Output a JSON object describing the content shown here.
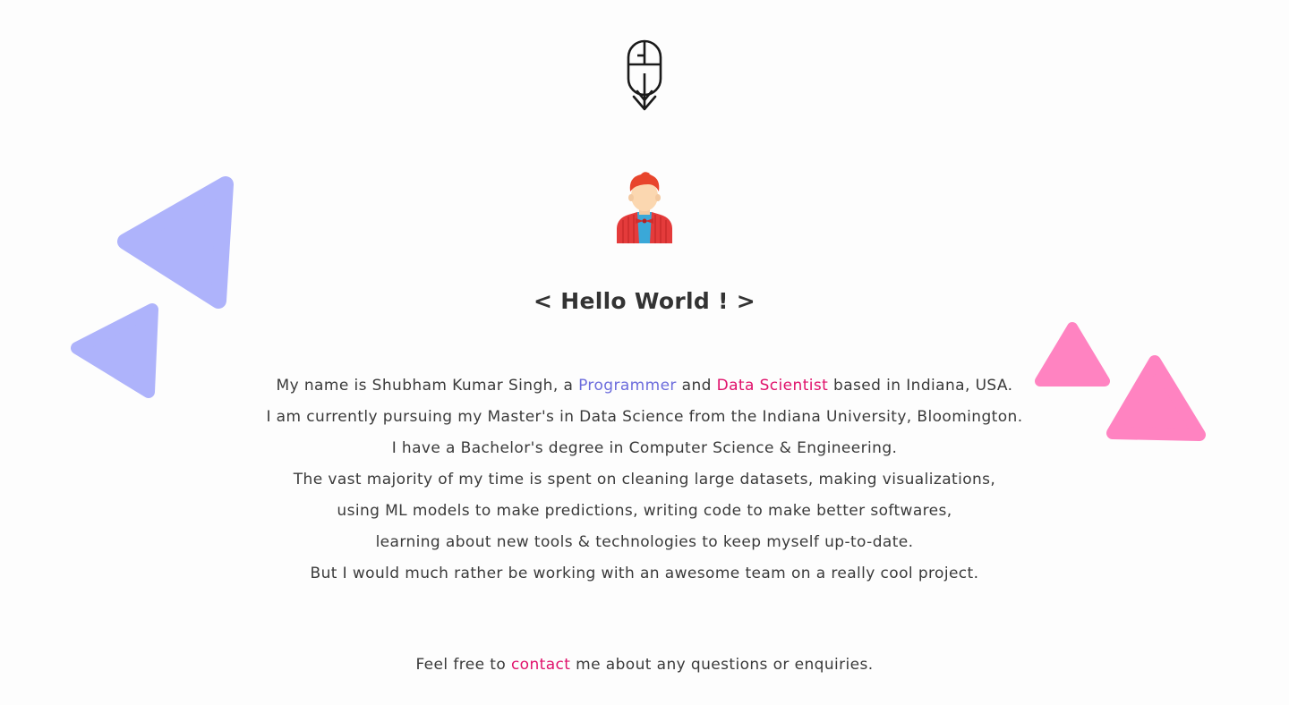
{
  "greeting": "< Hello World ! >",
  "bio": {
    "line1_prefix": "My name is Shubham Kumar Singh, a ",
    "line1_role1": "Programmer",
    "line1_mid": " and ",
    "line1_role2": "Data Scientist",
    "line1_suffix": " based in Indiana, USA.",
    "line2": "I am currently pursuing my Master's in Data Science from the Indiana University, Bloomington.",
    "line3": "I have a Bachelor's degree in Computer Science & Engineering.",
    "line4": "The vast majority of my time is spent on cleaning large datasets, making visualizations,",
    "line5": "using ML models to make predictions, writing code to make better softwares,",
    "line6": "learning about new tools & technologies to keep myself up-to-date.",
    "line7": "But I would much rather be working with an awesome team on a really cool project."
  },
  "contact": {
    "prefix": "Feel free to ",
    "link": "contact",
    "suffix": " me about any questions or enquiries."
  },
  "icons": {
    "scroll": "mouse-scroll-down-icon",
    "avatar": "developer-avatar-icon"
  },
  "colors": {
    "accent_purple": "#6c6cdc",
    "accent_pink": "#e0116b",
    "triangle_purple": "#aeb3fb",
    "triangle_pink": "#ff83c1"
  }
}
